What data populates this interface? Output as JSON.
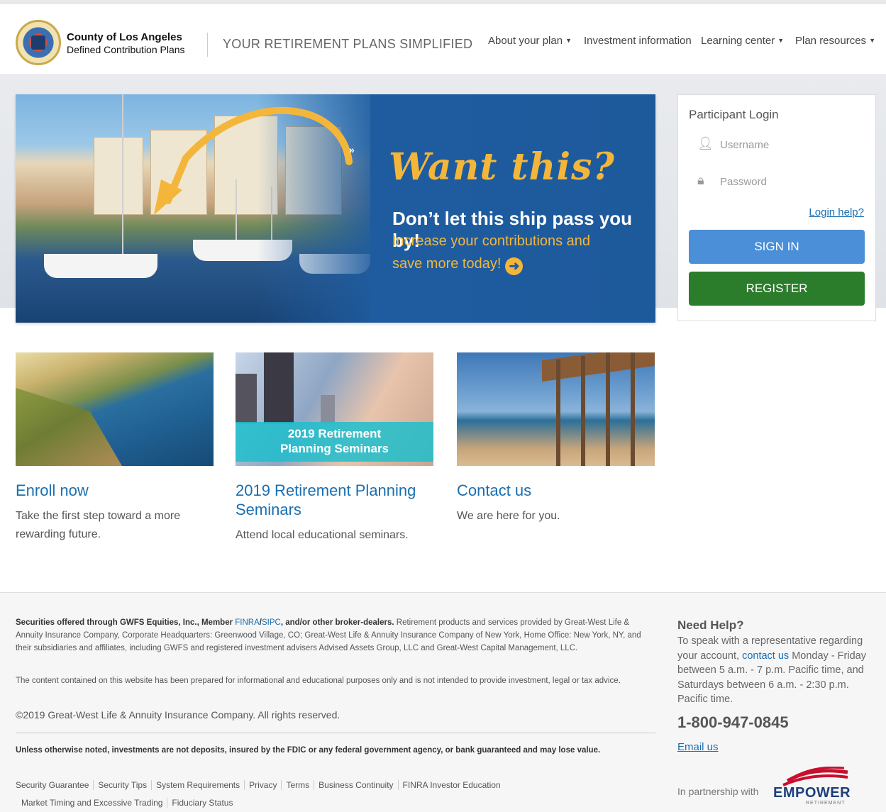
{
  "header": {
    "brand_name": "County of Los Angeles",
    "brand_sub": "Defined Contribution Plans",
    "tagline": "YOUR RETIREMENT PLANS SIMPLIFIED",
    "nav": [
      {
        "label": "About your plan",
        "dropdown": true
      },
      {
        "label": "Investment information",
        "dropdown": false
      },
      {
        "label": "Learning center",
        "dropdown": true
      },
      {
        "label": "Plan resources",
        "dropdown": true
      }
    ]
  },
  "hero": {
    "headline": "Want this?",
    "line1": "Don’t let this ship pass you by!",
    "line2": "Increase your contributions and",
    "line3": "save more today!",
    "chevron": "»"
  },
  "login": {
    "title": "Participant Login",
    "username_placeholder": "Username",
    "password_placeholder": "Password",
    "help_link": "Login help?",
    "sign_in": "SIGN IN",
    "register": "REGISTER"
  },
  "cards": [
    {
      "title": "Enroll now",
      "desc": "Take the first step toward a more rewarding future."
    },
    {
      "title": "2019 Retirement Planning Seminars",
      "desc": "Attend local educational seminars.",
      "banner_line1": "2019 Retirement",
      "banner_line2": "Planning Seminars"
    },
    {
      "title": "Contact us",
      "desc": "We are here for you."
    }
  ],
  "footer": {
    "securities_lead": "Securities offered through GWFS Equities, Inc., Member ",
    "finra": "FINRA",
    "sipc": "SIPC",
    "securities_mid": ", and/or other broker-dealers.",
    "securities_rest": " Retirement products and services provided by Great-West Life & Annuity Insurance Company, Corporate Headquarters: Greenwood Village, CO; Great-West Life & Annuity Insurance Company of New York, Home Office: New York, NY, and their subsidiaries and affiliates, including GWFS and registered investment advisers Advised Assets Group, LLC and Great-West Capital Management, LLC.",
    "content_note": "The content contained on this website has been prepared for informational and educational purposes only and is not intended to provide investment, legal or tax advice.",
    "copyright": "©2019 Great-West Life & Annuity Insurance Company. All rights reserved.",
    "fdic_note": "Unless otherwise noted, investments are not deposits, insured by the FDIC or any federal government agency, or bank guaranteed and may lose value.",
    "links_row1": [
      "Security Guarantee",
      "Security Tips",
      "System Requirements",
      "Privacy",
      "Terms",
      "Business Continuity",
      "FINRA Investor Education"
    ],
    "links_row2": [
      "Market Timing and Excessive Trading",
      "Fiduciary Status"
    ],
    "help_title": "Need Help?",
    "help_text_before": "To speak with a representative regarding your account, ",
    "help_contact_link": "contact us",
    "help_text_after": " Monday - Friday between 5 a.m. - 7 p.m. Pacific time, and Saturdays between 6 a.m. - 2:30 p.m. Pacific time.",
    "phone": "1-800-947-0845",
    "email_link": "Email us",
    "partnership": "In partnership with",
    "empower": "EMPOWER",
    "empower_sub": "RETIREMENT"
  },
  "colors": {
    "link": "#1a6fb0",
    "sign_in": "#4a8fd8",
    "register": "#2b7d2b",
    "hero_blue": "#1f5c9f",
    "hero_gold": "#f4b63a"
  }
}
